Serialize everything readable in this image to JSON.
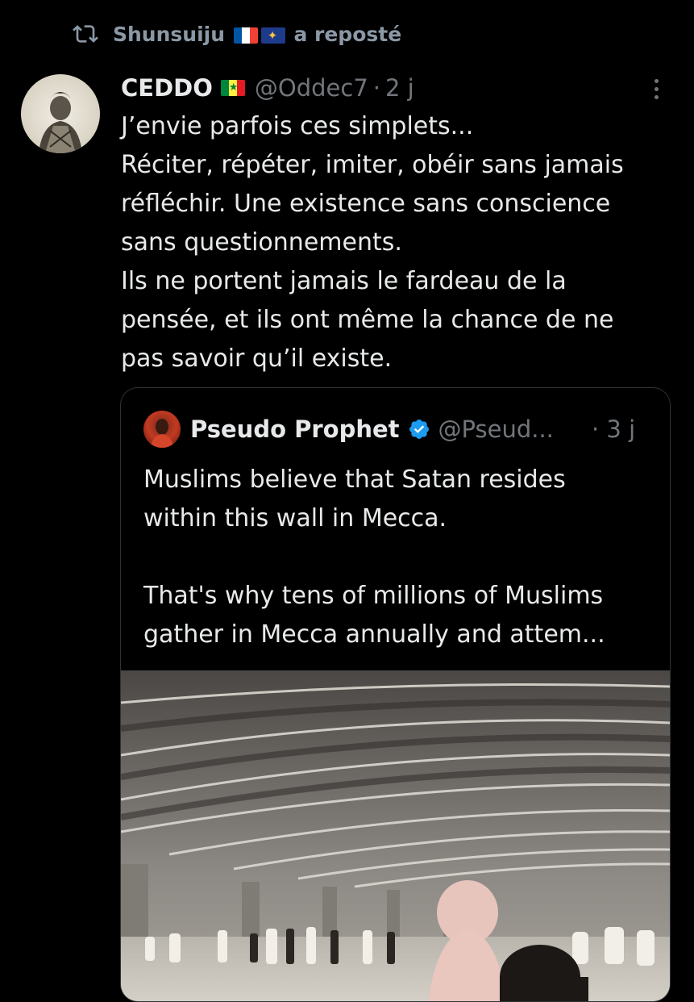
{
  "repost": {
    "reposter": "Shunsuiju",
    "suffix": "a reposté",
    "icon": "repost-icon"
  },
  "tweet": {
    "author_name": "CEDDO",
    "author_flag": "senegal-flag",
    "handle": "@Oddec7",
    "separator": "·",
    "time": "2 j",
    "lines": [
      "J’envie parfois ces simplets...",
      "Réciter, répéter, imiter, obéir sans jamais",
      "réfléchir. Une existence sans conscience",
      "sans questionnements.",
      "Ils ne portent jamais le fardeau de la",
      "pensée, et ils ont même la chance de ne",
      "pas savoir qu’il existe."
    ]
  },
  "quote": {
    "author_name": "Pseudo Prophet",
    "verified": true,
    "handle": "@Pseud...",
    "time": "· 3 j",
    "paragraph1": [
      "Muslims believe that Satan resides",
      "within this wall in Mecca."
    ],
    "paragraph2": [
      "That's why tens of millions of Muslims",
      "gather in Mecca annually and attem..."
    ]
  },
  "colors": {
    "background": "#000000",
    "text": "#e7e9ea",
    "muted": "#71767b",
    "verified": "#1d9bf0",
    "border": "#2f3336"
  }
}
